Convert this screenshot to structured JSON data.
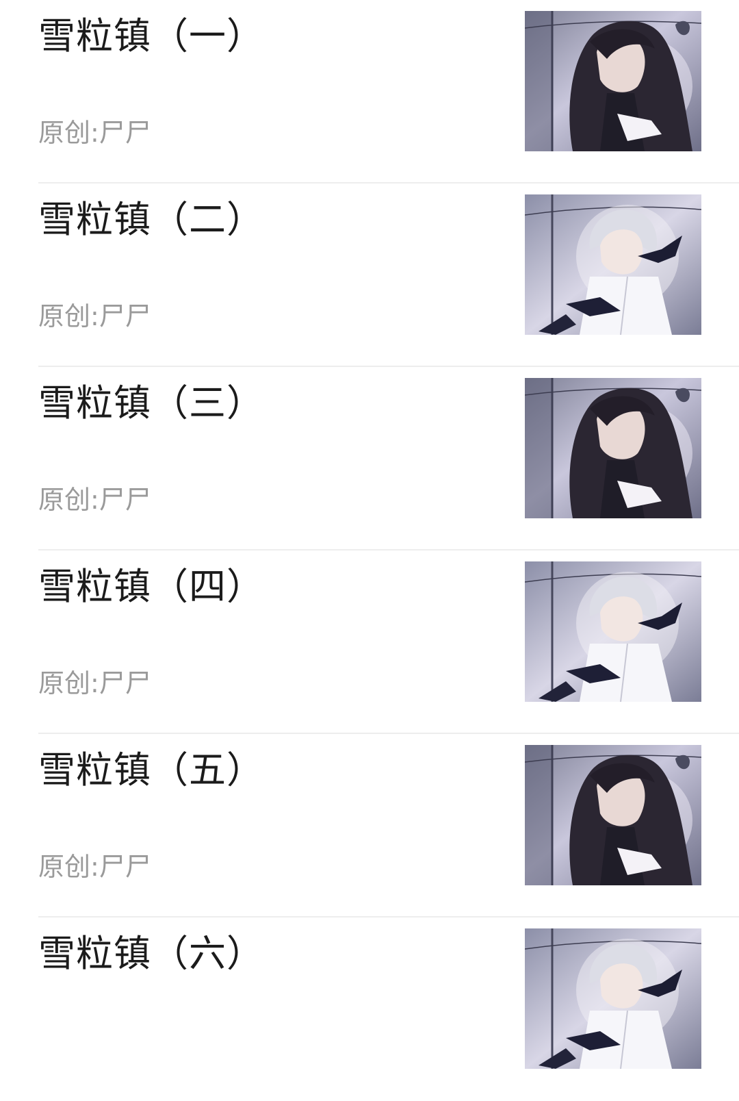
{
  "articles": [
    {
      "title": "雪粒镇（一）",
      "meta": "原创:尸尸",
      "thumbnail": "dark-haired-character-illustration"
    },
    {
      "title": "雪粒镇（二）",
      "meta": "原创:尸尸",
      "thumbnail": "silver-haired-character-with-crows-illustration"
    },
    {
      "title": "雪粒镇（三）",
      "meta": "原创:尸尸",
      "thumbnail": "dark-haired-character-illustration"
    },
    {
      "title": "雪粒镇（四）",
      "meta": "原创:尸尸",
      "thumbnail": "silver-haired-character-with-crows-illustration"
    },
    {
      "title": "雪粒镇（五）",
      "meta": "原创:尸尸",
      "thumbnail": "dark-haired-character-illustration"
    },
    {
      "title": "雪粒镇（六）",
      "meta": "",
      "thumbnail": "silver-haired-character-with-crows-illustration"
    }
  ]
}
